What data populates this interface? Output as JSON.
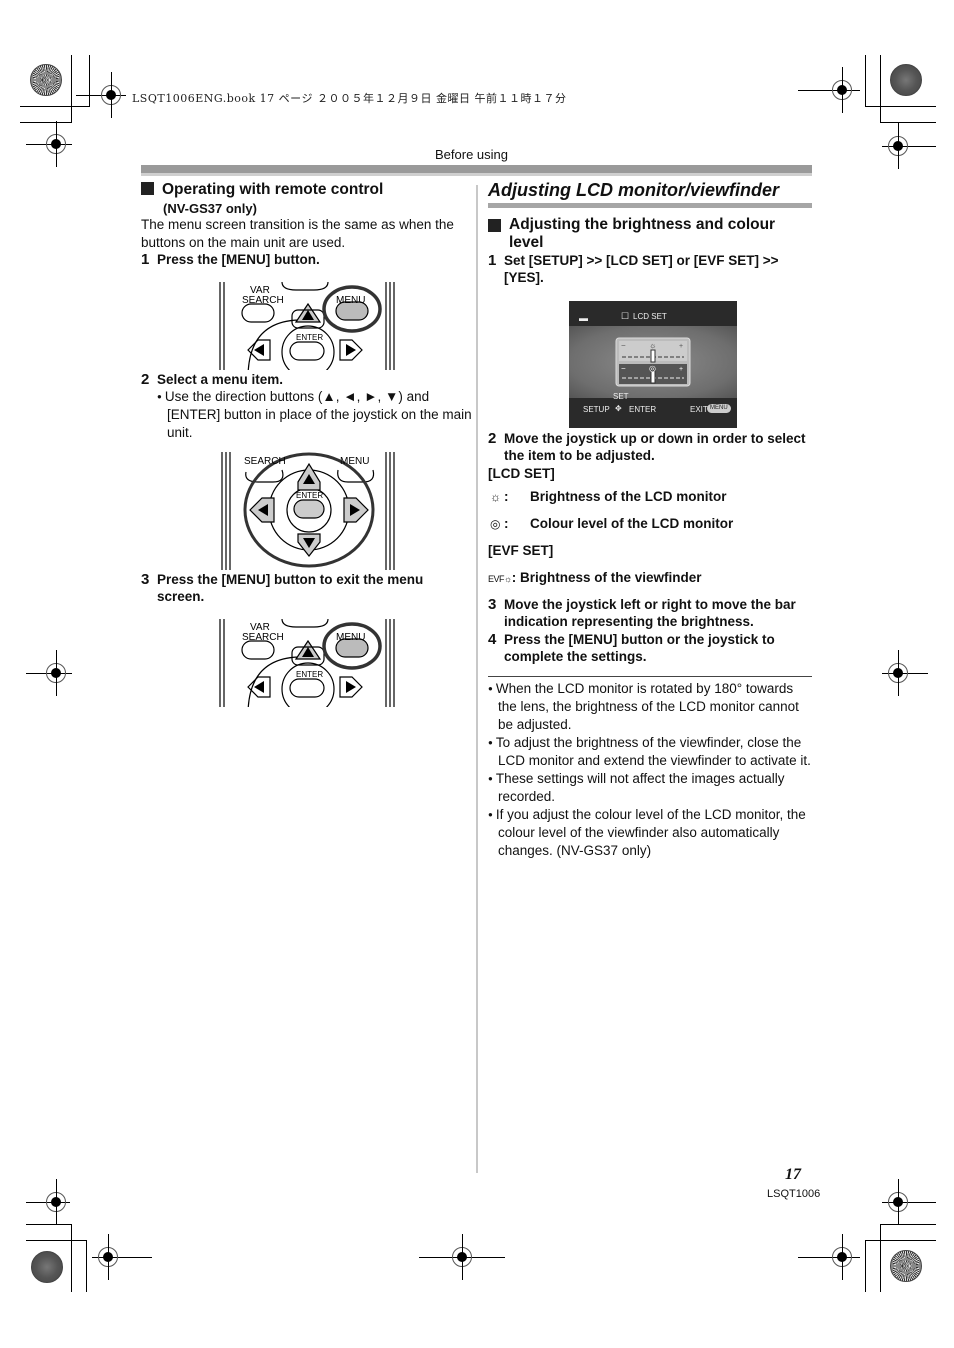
{
  "print_header": "LSQT1006ENG.book  17 ページ  ２００５年１２月９日  金曜日  午前１１時１７分",
  "running_head": "Before using",
  "left_column": {
    "section_title": "Operating with remote control",
    "section_subtitle": "(NV-GS37 only)",
    "intro": "The menu screen transition is the same as when the buttons on the main unit are used.",
    "steps": [
      {
        "num": "1",
        "text": "Press the [MENU] button."
      },
      {
        "num": "2",
        "text": "Select a menu item.",
        "bullet": "Use the direction buttons (▲, ◄, ►, ▼) and [ENTER] button in place of the joystick on the main unit."
      },
      {
        "num": "3",
        "text": "Press the [MENU] button to exit the menu screen."
      }
    ],
    "remote_labels": {
      "var": "VAR",
      "search": "SEARCH",
      "menu": "MENU",
      "enter": "ENTER"
    }
  },
  "right_column": {
    "title": "Adjusting LCD monitor/viewfinder",
    "section_title": "Adjusting the brightness and colour level",
    "steps": [
      {
        "num": "1",
        "text": "Set [SETUP] >> [LCD SET] or [EVF SET] >> [YES]."
      },
      {
        "num": "2",
        "text": "Move the joystick up or down in order to select the item to be adjusted."
      },
      {
        "num": "3",
        "text": "Move the joystick left or right to move the bar indication representing the brightness."
      },
      {
        "num": "4",
        "text": "Press the [MENU] button or the joystick to complete the settings."
      }
    ],
    "lcd_screen": {
      "title": "LCD SET",
      "set_label": "SET",
      "setup_label": "SETUP",
      "enter_label": "ENTER",
      "exit_label": "EXIT",
      "menu_badge": "MENU",
      "brightness_level": 0.5,
      "colour_level": 0.5
    },
    "lcd_set_heading": "[LCD SET]",
    "lcd_set_items": [
      {
        "icon": "brightness-icon",
        "glyph": "☼",
        "label": "Brightness of the LCD monitor"
      },
      {
        "icon": "colour-level-icon",
        "glyph": "◎",
        "label": "Colour level of the LCD monitor"
      }
    ],
    "evf_set_heading": "[EVF SET]",
    "evf_set_items": [
      {
        "icon": "evf-brightness-icon",
        "glyph": "EVF☼",
        "label": "Brightness of the viewfinder"
      }
    ],
    "notes": [
      "When the LCD monitor is rotated by 180° towards the lens, the brightness of the LCD monitor cannot be adjusted.",
      "To adjust the brightness of the viewfinder, close the LCD monitor and extend the viewfinder to activate it.",
      "These settings will not affect the images actually recorded.",
      "If you adjust the colour level of the LCD monitor, the colour level of the viewfinder also automatically changes. (NV-GS37 only)"
    ]
  },
  "footer": {
    "page_number": "17",
    "doc_code": "LSQT1006"
  }
}
